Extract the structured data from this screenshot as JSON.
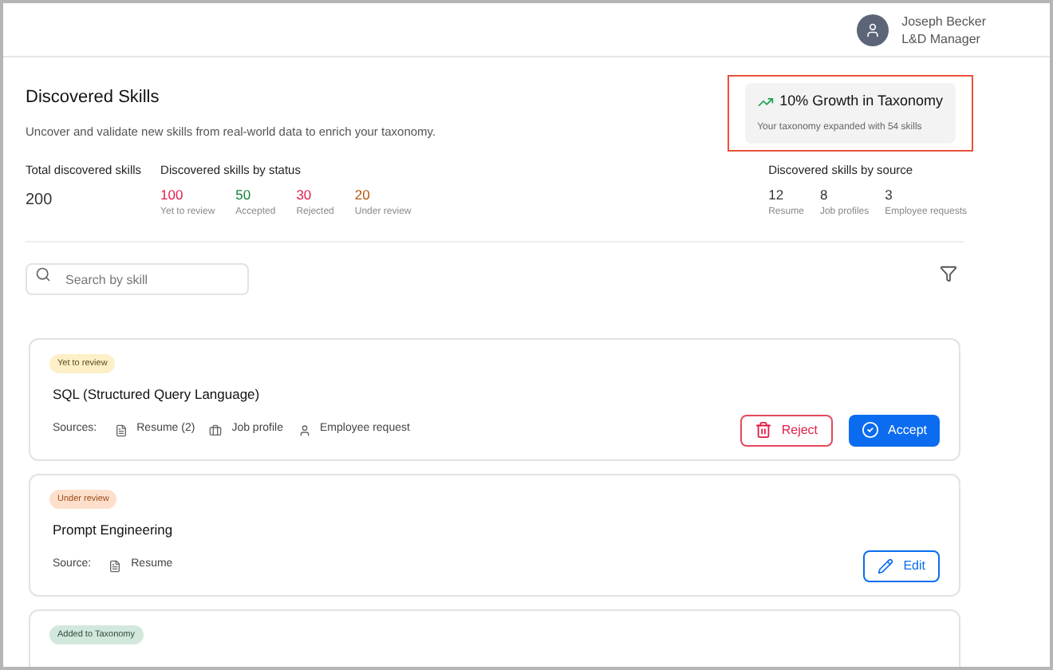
{
  "user": {
    "name": "Joseph Becker",
    "role": "L&D Manager"
  },
  "page": {
    "title": "Discovered Skills",
    "subtitle": "Uncover and validate new skills from real-world data to enrich your taxonomy."
  },
  "growth": {
    "title": "10% Growth in Taxonomy",
    "subtitle": "Your taxonomy expanded with 54 skills"
  },
  "total": {
    "label": "Total discovered skills",
    "value": "200"
  },
  "by_status": {
    "label": "Discovered skills by status",
    "items": [
      {
        "value": "100",
        "label": "Yet to review",
        "color": "#e11d48"
      },
      {
        "value": "50",
        "label": "Accepted",
        "color": "#15803d"
      },
      {
        "value": "30",
        "label": "Rejected",
        "color": "#e11d48"
      },
      {
        "value": "20",
        "label": "Under review",
        "color": "#b45309"
      }
    ]
  },
  "by_source": {
    "label": "Discovered skills by source",
    "items": [
      {
        "value": "12",
        "label": "Resume"
      },
      {
        "value": "8",
        "label": "Job profiles"
      },
      {
        "value": "3",
        "label": "Employee requests"
      }
    ]
  },
  "search": {
    "placeholder": "Search by skill"
  },
  "cards": [
    {
      "status": "Yet to review",
      "kind": "yet",
      "title": "SQL (Structured Query Language)",
      "sources_label": "Sources:",
      "sources": [
        {
          "kind": "document",
          "label": "Resume (2)"
        },
        {
          "kind": "briefcase",
          "label": "Job profile"
        },
        {
          "kind": "person",
          "label": "Employee request"
        }
      ],
      "actions": [
        {
          "kind": "reject",
          "label": "Reject"
        },
        {
          "kind": "accept",
          "label": "Accept"
        }
      ]
    },
    {
      "status": "Under review",
      "kind": "under",
      "title": "Prompt Engineering",
      "sources_label": "Source:",
      "sources": [
        {
          "kind": "document",
          "label": "Resume"
        }
      ],
      "actions": [
        {
          "kind": "edit",
          "label": "Edit"
        }
      ]
    },
    {
      "status": "Added to Taxonomy",
      "kind": "added"
    }
  ]
}
